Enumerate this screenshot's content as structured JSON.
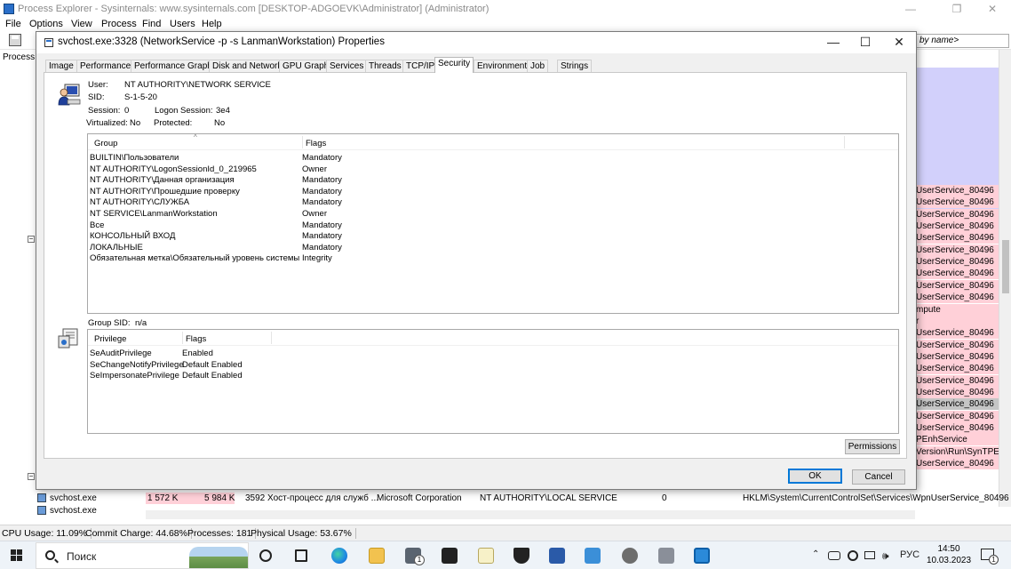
{
  "app": {
    "title": "Process Explorer - Sysinternals: www.sysinternals.com [DESKTOP-ADGOEVK\\Administrator] (Administrator)",
    "menu": [
      "File",
      "Options",
      "View",
      "Process",
      "Find",
      "Users",
      "Help"
    ],
    "filter_placeholder": "by name>",
    "left_label": "Process",
    "window_controls": [
      "—",
      "❐",
      "✕"
    ]
  },
  "right_rows": [
    "UserService_80496",
    "UserService_80496",
    "UserService_80496",
    "UserService_80496",
    "UserService_80496",
    "UserService_80496",
    "UserService_80496",
    "UserService_80496",
    "UserService_80496",
    "UserService_80496",
    "mpute",
    "r",
    "UserService_80496",
    "UserService_80496",
    "UserService_80496",
    "UserService_80496",
    "UserService_80496",
    "UserService_80496",
    "UserService_80496",
    "UserService_80496",
    "UserService_80496",
    "PEnhService",
    "Version\\Run\\SynTPEnh",
    "UserService_80496"
  ],
  "process_rows": [
    {
      "name": "svchost.exe",
      "private": "1 572 K",
      "working": "5 984 K",
      "pid_desc": "3592 Хост-процесс для служб ...",
      "company": "Microsoft Corporation",
      "user": "NT AUTHORITY\\LOCAL SERVICE",
      "session": "0",
      "path": "HKLM\\System\\CurrentControlSet\\Services\\WpnUserService_80496"
    },
    {
      "name": "svchost.exe",
      "private": "",
      "working": "",
      "pid_desc": "",
      "company": "",
      "user": "",
      "session": "",
      "path": ""
    }
  ],
  "status": [
    "CPU Usage: 11.09%",
    "Commit Charge: 44.68%",
    "Processes: 181",
    "Physical Usage: 53.67%"
  ],
  "dialog": {
    "title": "svchost.exe:3328 (NetworkService -p -s LanmanWorkstation) Properties",
    "tabs": [
      "Image",
      "Performance",
      "Performance Graph",
      "Disk and Network",
      "GPU Graph",
      "Services",
      "Threads",
      "TCP/IP",
      "Security",
      "Environment",
      "Job",
      "Strings"
    ],
    "active_tab": "Security",
    "user_label": "User:",
    "user_value": "NT AUTHORITY\\NETWORK SERVICE",
    "sid_label": "SID:",
    "sid_value": "S-1-5-20",
    "session_label": "Session:",
    "session_value": "0",
    "logon_label": "Logon Session:",
    "logon_value": "3e4",
    "virtualized_label": "Virtualized:",
    "virtualized_value": "No",
    "protected_label": "Protected:",
    "protected_value": "No",
    "group_col": "Group",
    "flags_col": "Flags",
    "groups": [
      {
        "group": "BUILTIN\\Пользователи",
        "flags": "Mandatory"
      },
      {
        "group": "NT AUTHORITY\\LogonSessionId_0_219965",
        "flags": "Owner"
      },
      {
        "group": "NT AUTHORITY\\Данная организация",
        "flags": "Mandatory"
      },
      {
        "group": "NT AUTHORITY\\Прошедшие проверку",
        "flags": "Mandatory"
      },
      {
        "group": "NT AUTHORITY\\СЛУЖБА",
        "flags": "Mandatory"
      },
      {
        "group": "NT SERVICE\\LanmanWorkstation",
        "flags": "Owner"
      },
      {
        "group": "Все",
        "flags": "Mandatory"
      },
      {
        "group": "КОНСОЛЬНЫЙ ВХОД",
        "flags": "Mandatory"
      },
      {
        "group": "ЛОКАЛЬНЫЕ",
        "flags": "Mandatory"
      },
      {
        "group": "Обязательная метка\\Обязательный уровень системы",
        "flags": "Integrity"
      }
    ],
    "group_sid_label": "Group SID:",
    "group_sid_value": "n/a",
    "privilege_col": "Privilege",
    "priv_flags_col": "Flags",
    "privileges": [
      {
        "privilege": "SeAuditPrivilege",
        "flags": "Enabled"
      },
      {
        "privilege": "SeChangeNotifyPrivilege",
        "flags": "Default Enabled"
      },
      {
        "privilege": "SeImpersonatePrivilege",
        "flags": "Default Enabled"
      }
    ],
    "permissions_button": "Permissions",
    "ok_button": "OK",
    "cancel_button": "Cancel",
    "controls": [
      "—",
      "☐",
      "✕"
    ]
  },
  "taskbar": {
    "search_placeholder": "Поиск",
    "language": "РУС",
    "time": "14:50",
    "date": "10.03.2023",
    "notification_count": "1",
    "mail_count": "1"
  }
}
